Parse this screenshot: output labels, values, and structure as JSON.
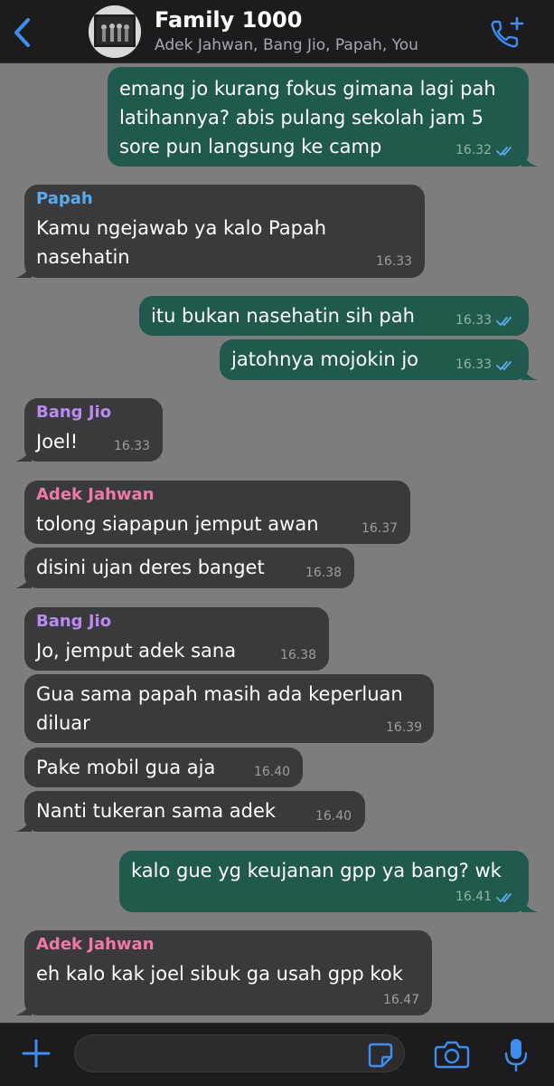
{
  "header": {
    "title": "Family 1000",
    "members": "Adek Jahwan, Bang Jio, Papah, You"
  },
  "colors": {
    "incoming": "#3a3a3c",
    "outgoing": "#1f5a4c",
    "accent": "#3d8ef0",
    "papah": "#5aaaf0",
    "bang_jio": "#b88bf0",
    "adek_jahwan": "#f07aa6"
  },
  "icons": {
    "back": "chevron-left-icon",
    "call": "phone-plus-icon",
    "attach": "plus-icon",
    "sticker": "sticker-icon",
    "camera": "camera-icon",
    "mic": "mic-icon",
    "read": "double-check-icon"
  },
  "messages": [
    {
      "sender": "",
      "text": "emang jo kurang fokus gimana lagi pah\nlatihannya? abis pulang sekolah jam 5\nsore pun langsung ke camp",
      "time": "16.32"
    },
    {
      "sender": "Papah",
      "text": "Kamu ngejawab ya kalo Papah\nnasehatin",
      "time": "16.33"
    },
    {
      "sender": "",
      "text": "itu bukan nasehatin sih pah",
      "time": "16.33"
    },
    {
      "sender": "",
      "text": "jatohnya mojokin jo",
      "time": "16.33"
    },
    {
      "sender": "Bang Jio",
      "text": "Joel!",
      "time": "16.33"
    },
    {
      "sender": "Adek Jahwan",
      "text": "tolong siapapun jemput awan",
      "time": "16.37"
    },
    {
      "sender": "",
      "text": "disini ujan deres banget",
      "time": "16.38"
    },
    {
      "sender": "Bang Jio",
      "text": "Jo, jemput adek sana",
      "time": "16.38"
    },
    {
      "sender": "",
      "text": "Gua sama papah masih ada keperluan\ndiluar",
      "time": "16.39"
    },
    {
      "sender": "",
      "text": "Pake mobil gua aja",
      "time": "16.40"
    },
    {
      "sender": "",
      "text": "Nanti tukeran sama adek",
      "time": "16.40"
    },
    {
      "sender": "",
      "text": "kalo gue yg keujanan gpp ya bang? wk",
      "time": "16.41"
    },
    {
      "sender": "Adek Jahwan",
      "text": "eh kalo kak joel sibuk ga usah gpp kok",
      "time": "16.47"
    }
  ],
  "composer": {
    "value": "",
    "placeholder": ""
  }
}
